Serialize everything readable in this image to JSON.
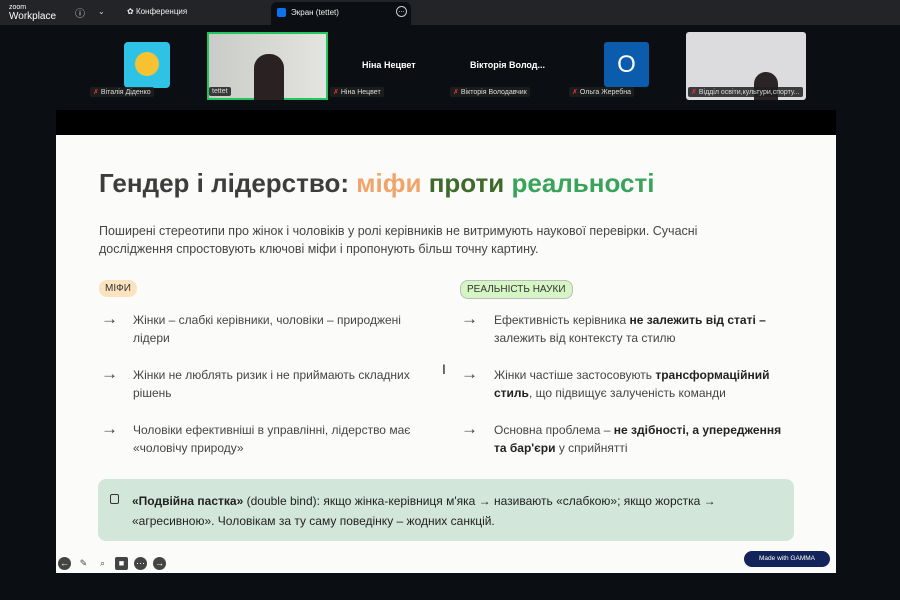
{
  "app": {
    "logo_top": "zoom",
    "logo_bottom": "Workplace",
    "conference_tab": "Конференция",
    "screen_tab": "Экран (tettet)"
  },
  "participants": [
    {
      "label": "Віталія Діденко"
    },
    {
      "label": "tettet"
    },
    {
      "label": "Ніна Нецвет",
      "big": "Ніна Нецвет"
    },
    {
      "label": "Вікторія Володавчик",
      "big": "Вікторія Волод..."
    },
    {
      "label": "Ольга Жеребна",
      "initial": "О"
    },
    {
      "label": "Відділ освіти,культури,спорту..."
    }
  ],
  "slide": {
    "title_a": "Гендер і лідерство:",
    "title_b": " міфи",
    "title_c": " проти",
    "title_d": " реальності",
    "intro": "Поширені стереотипи про жінок і чоловіків у ролі керівників не витримують наукової перевірки. Сучасні дослідження спростовують ключові міфи і пропонують більш точну картину.",
    "myths_label": "МІФИ",
    "reality_label": "РЕАЛЬНІСТЬ НАУКИ",
    "myths": [
      "Жінки – слабкі керівники, чоловіки – природжені лідери",
      "Жінки не люблять ризик і не приймають складних рішень",
      "Чоловіки ефективніші в управлінні, лідерство має «чоловічу природу»"
    ],
    "reality": [
      {
        "a": "Ефективність керівника ",
        "b": "не залежить від статі –",
        "c": " залежить від контексту та стилю"
      },
      {
        "a": "Жінки частіше застосовують ",
        "b": "трансформаційний стиль",
        "c": ", що підвищує залученість команди"
      },
      {
        "a": "Основна проблема – ",
        "b": "не здібності, а упередження та бар'єри",
        "c": " у сприйнятті"
      }
    ],
    "note_bold": "«Подвійна пастка»",
    "note_rest": " (double bind): якщо жінка-керівниця м'яка → називають «слабкою»; якщо жорстка → «агресивною». Чоловікам за ту саму поведінку – жодних санкцій.",
    "made_with": "Made with GAMMA"
  }
}
